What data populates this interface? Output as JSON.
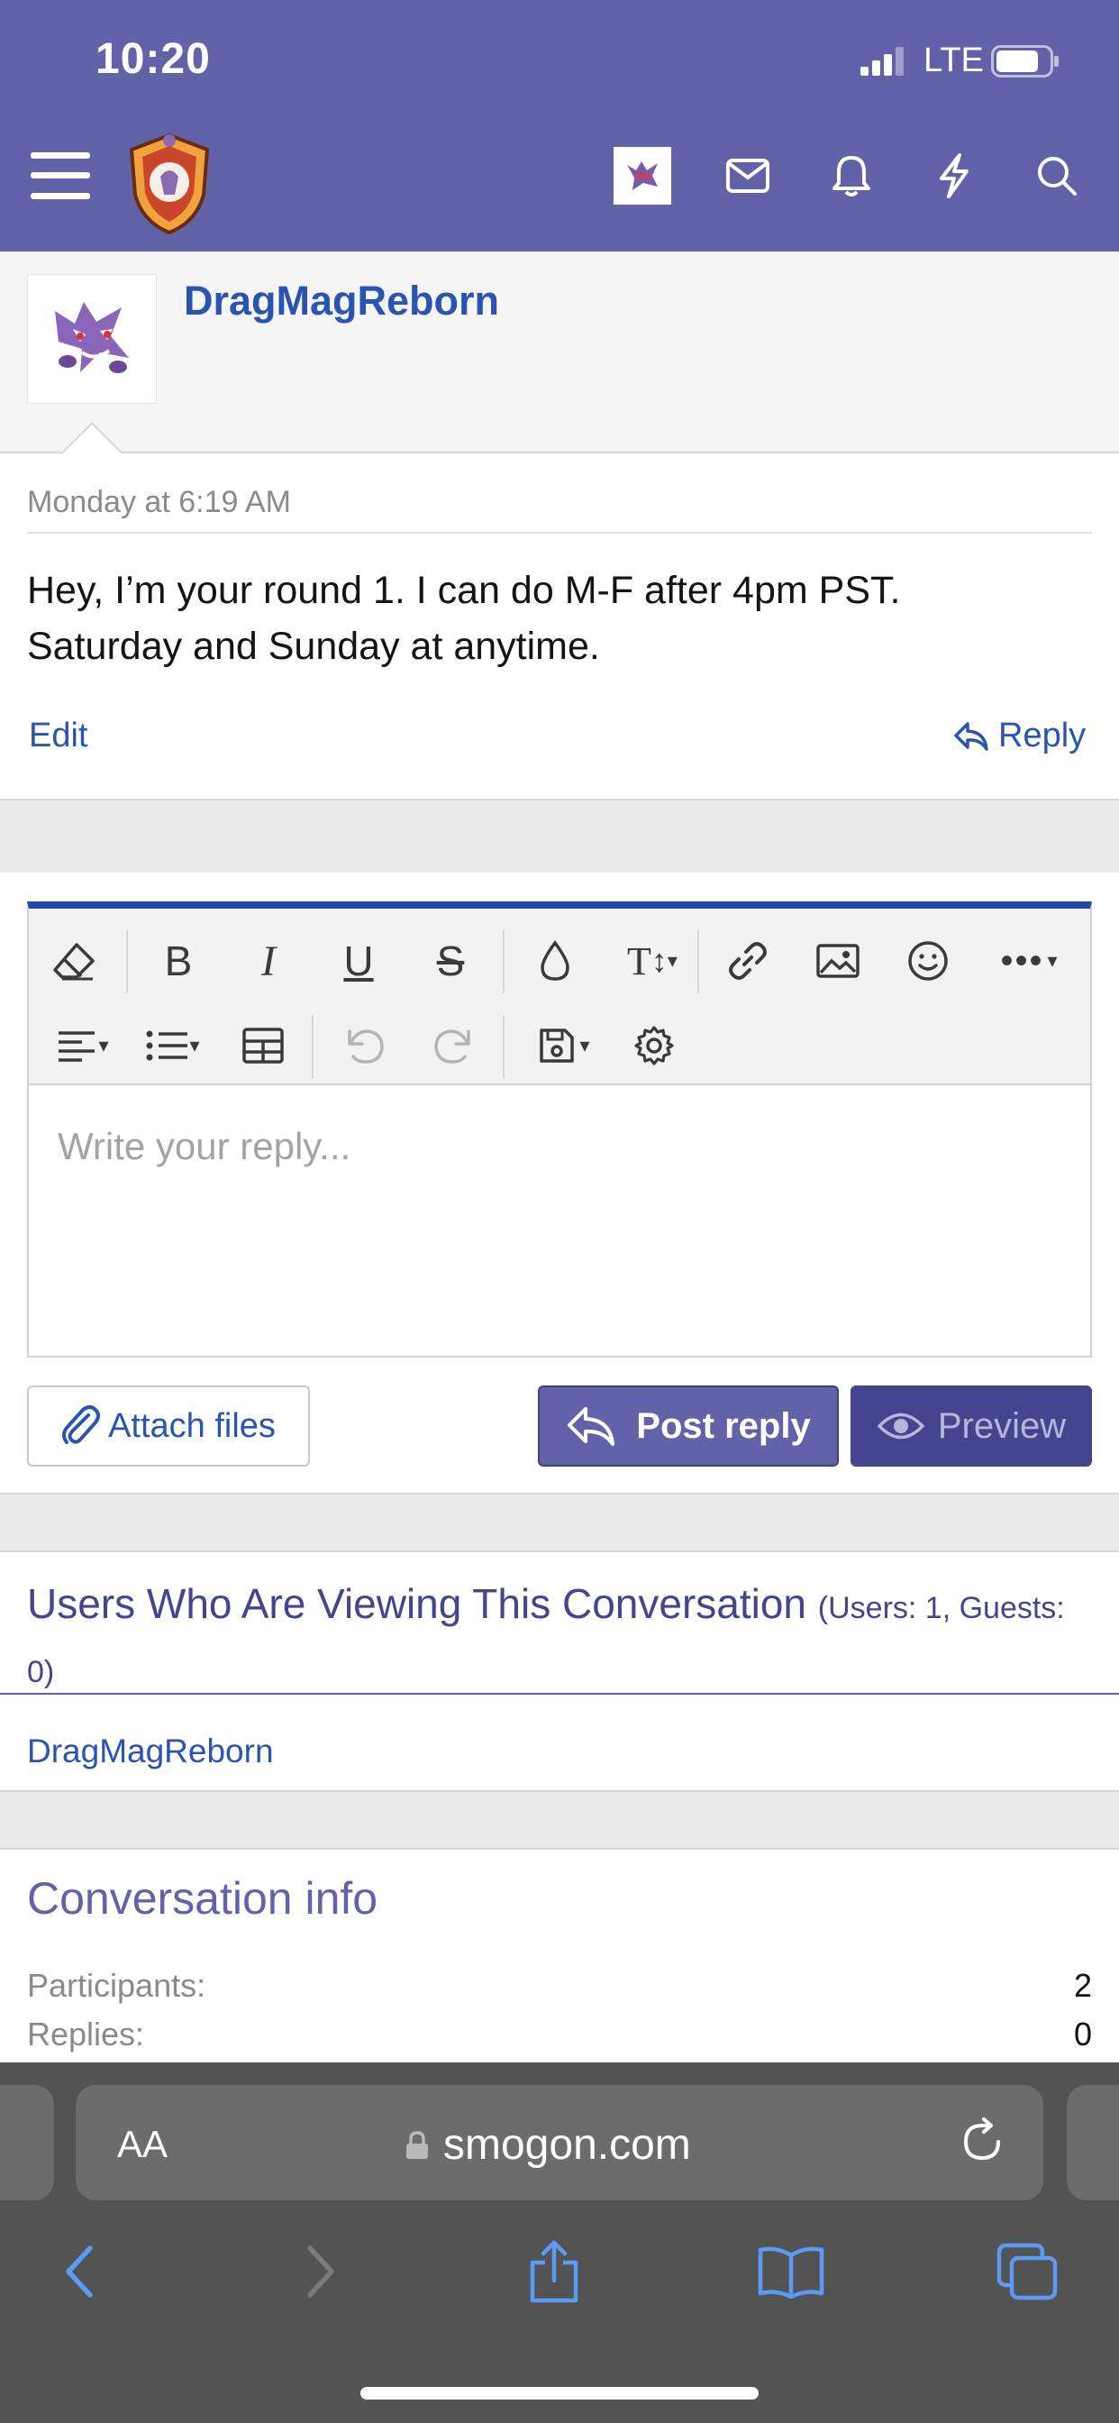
{
  "status_bar": {
    "time": "10:20",
    "network": "LTE",
    "battery_level": 0.8
  },
  "nav": {
    "icons": [
      "menu-icon",
      "site-logo",
      "user-avatar",
      "mail-icon",
      "bell-icon",
      "bolt-icon",
      "search-icon"
    ]
  },
  "post": {
    "username": "DragMagReborn",
    "timestamp": "Monday at 6:19 AM",
    "message": "Hey, I’m your round 1. I can do M-F after 4pm PST. Saturday and Sunday at anytime.",
    "edit_label": "Edit",
    "reply_label": "Reply"
  },
  "editor": {
    "placeholder": "Write your reply...",
    "toolbar_row1": [
      "eraser-icon",
      "bold-icon",
      "italic-icon",
      "underline-icon",
      "strikethrough-icon",
      "text-color-icon",
      "font-size-icon",
      "link-icon",
      "image-icon",
      "smiley-icon",
      "more-icon"
    ],
    "toolbar_row2": [
      "align-icon",
      "list-icon",
      "table-icon",
      "undo-icon",
      "redo-icon",
      "save-draft-icon",
      "settings-icon"
    ],
    "attach_label": "Attach files",
    "post_reply_label": "Post reply",
    "preview_label": "Preview"
  },
  "viewers": {
    "title": "Users Who Are Viewing This Conversation",
    "counts": "(Users: 1, Guests: 0)",
    "users": [
      "DragMagReborn"
    ]
  },
  "conversation_info": {
    "title": "Conversation info",
    "participants_label": "Participants:",
    "participants_value": "2",
    "replies_label": "Replies:",
    "replies_value": "0"
  },
  "browser": {
    "text_size_label": "AA",
    "url": "smogon.com"
  },
  "colors": {
    "header": "#6262a8",
    "link": "#2b54b1",
    "button_primary": "#6262a8",
    "button_preview": "#45458f"
  }
}
